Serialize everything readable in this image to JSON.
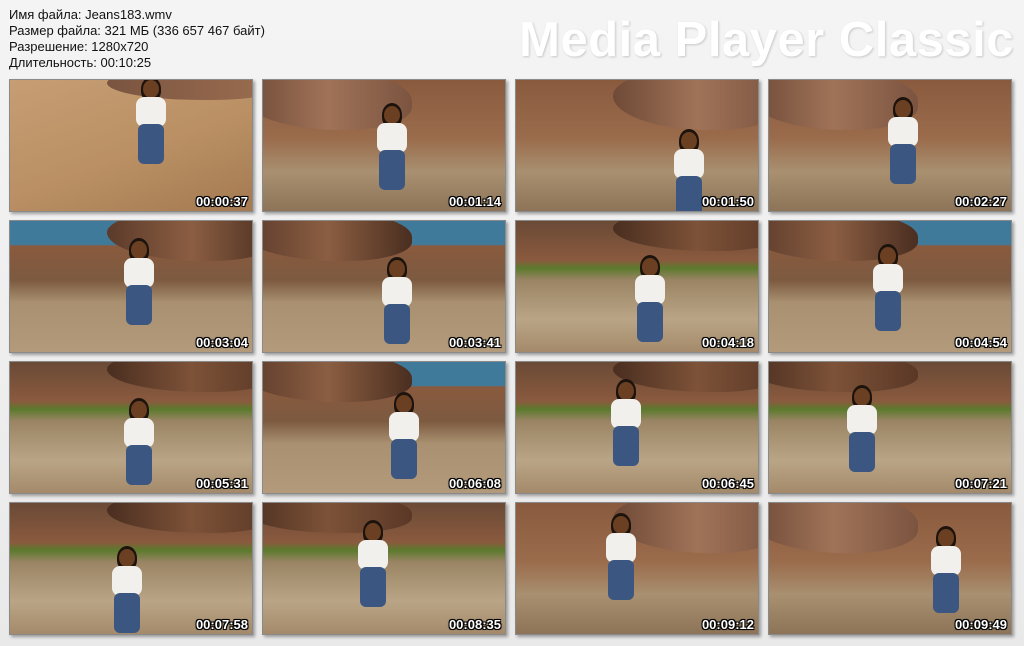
{
  "file_info": {
    "name_line": "Имя файла: Jeans183.wmv",
    "size_line": "Размер файла: 321 МБ (336 657 467 байт)",
    "resolution_line": "Разрешение: 1280x720",
    "duration_line": "Длительность: 00:10:25"
  },
  "brand": "Media Player Classic",
  "thumbnails": [
    {
      "time": "00:00:37",
      "scene": "sand"
    },
    {
      "time": "00:01:14",
      "scene": "rocks"
    },
    {
      "time": "00:01:50",
      "scene": "rocks"
    },
    {
      "time": "00:02:27",
      "scene": "rocks"
    },
    {
      "time": "00:03:04",
      "scene": "sea"
    },
    {
      "time": "00:03:41",
      "scene": "sea"
    },
    {
      "time": "00:04:18",
      "scene": "water"
    },
    {
      "time": "00:04:54",
      "scene": "sea"
    },
    {
      "time": "00:05:31",
      "scene": "water"
    },
    {
      "time": "00:06:08",
      "scene": "sea"
    },
    {
      "time": "00:06:45",
      "scene": "water"
    },
    {
      "time": "00:07:21",
      "scene": "water"
    },
    {
      "time": "00:07:58",
      "scene": "water"
    },
    {
      "time": "00:08:35",
      "scene": "water"
    },
    {
      "time": "00:09:12",
      "scene": "rocks"
    },
    {
      "time": "00:09:49",
      "scene": "rocks"
    }
  ],
  "colors": {
    "sand": "#b98f63",
    "rock": "#8a5a3e",
    "rock_dark": "#4a2e20",
    "water": "#a89070",
    "sea": "#3f7a9a",
    "moss": "#5b7a2c"
  }
}
